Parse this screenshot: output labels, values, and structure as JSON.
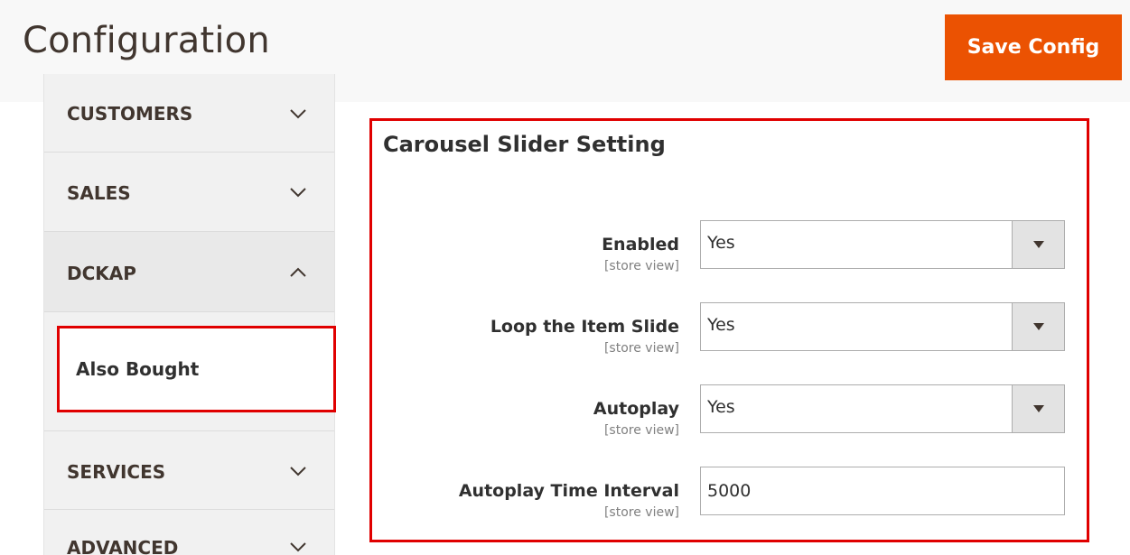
{
  "header": {
    "title": "Configuration",
    "save_label": "Save Config"
  },
  "sidebar": {
    "tabs": [
      {
        "label": "CUSTOMERS",
        "expanded": false,
        "icon": "chevron-down-icon"
      },
      {
        "label": "SALES",
        "expanded": false,
        "icon": "chevron-down-icon"
      },
      {
        "label": "DCKAP",
        "expanded": true,
        "icon": "chevron-up-icon"
      },
      {
        "label": "SERVICES",
        "expanded": false,
        "icon": "chevron-down-icon"
      },
      {
        "label": "ADVANCED",
        "expanded": false,
        "icon": "chevron-down-icon"
      }
    ],
    "dckap_items": [
      {
        "label": "Also Bought"
      }
    ]
  },
  "section": {
    "title": "Carousel Slider Setting",
    "fields": [
      {
        "label": "Enabled",
        "scope": "[store view]",
        "type": "select",
        "value": "Yes"
      },
      {
        "label": "Loop the Item Slide",
        "scope": "[store view]",
        "type": "select",
        "value": "Yes"
      },
      {
        "label": "Autoplay",
        "scope": "[store view]",
        "type": "select",
        "value": "Yes"
      },
      {
        "label": "Autoplay Time Interval",
        "scope": "[store view]",
        "type": "text",
        "value": "5000"
      }
    ]
  },
  "colors": {
    "accent": "#eb5202",
    "highlight_border": "#e00000",
    "header_bg": "#f8f8f8",
    "sidebar_bg": "#f1f1f1"
  }
}
